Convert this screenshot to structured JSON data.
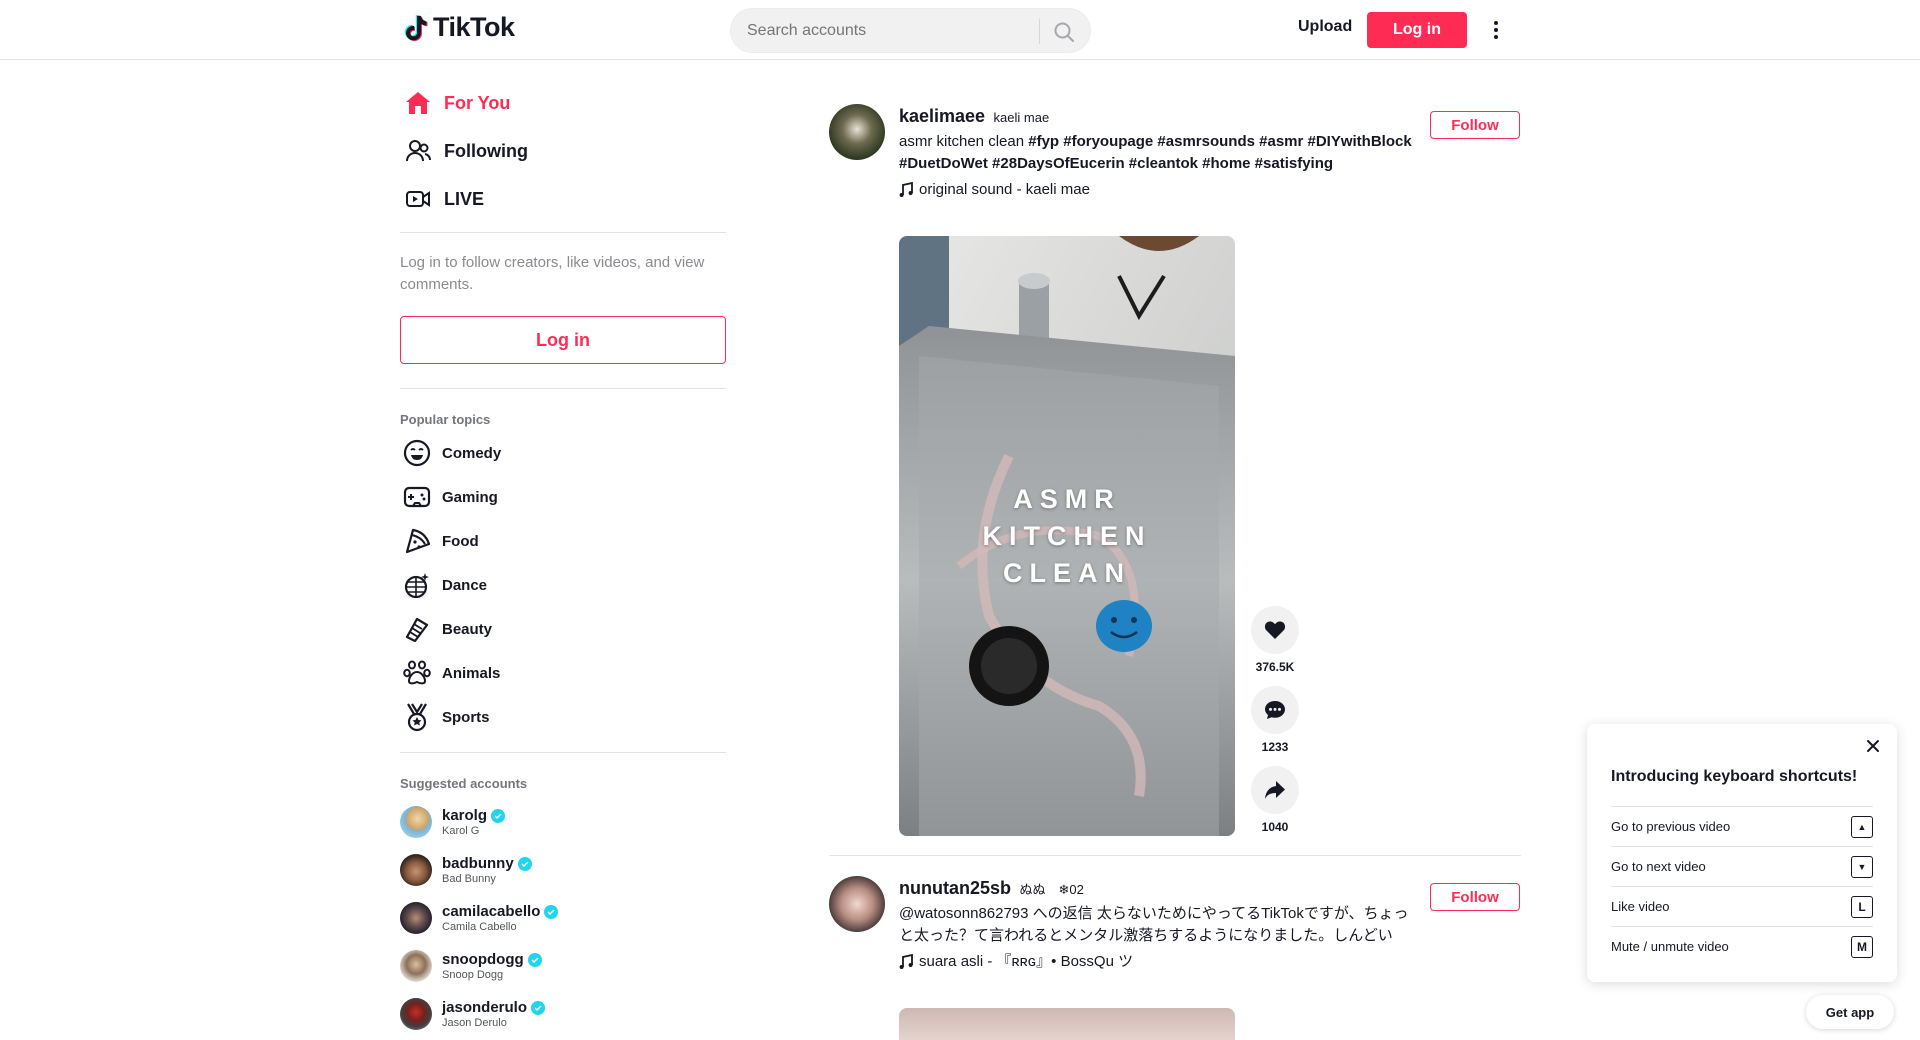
{
  "header": {
    "logo_text": "TikTok",
    "search_placeholder": "Search accounts",
    "upload_label": "Upload",
    "login_label": "Log in"
  },
  "sidebar": {
    "nav": [
      {
        "label": "For You",
        "icon": "home-icon",
        "active": true
      },
      {
        "label": "Following",
        "icon": "users-icon",
        "active": false
      },
      {
        "label": "LIVE",
        "icon": "live-icon",
        "active": false
      }
    ],
    "login_hint": "Log in to follow creators, like videos, and view comments.",
    "login_label": "Log in",
    "popular_topics_title": "Popular topics",
    "topics": [
      {
        "label": "Comedy",
        "icon": "laugh-face-icon"
      },
      {
        "label": "Gaming",
        "icon": "gamepad-icon"
      },
      {
        "label": "Food",
        "icon": "pizza-icon"
      },
      {
        "label": "Dance",
        "icon": "disco-ball-icon"
      },
      {
        "label": "Beauty",
        "icon": "comb-icon"
      },
      {
        "label": "Animals",
        "icon": "paw-icon"
      },
      {
        "label": "Sports",
        "icon": "medal-icon"
      }
    ],
    "suggested_title": "Suggested accounts",
    "accounts": [
      {
        "user": "karolg",
        "name": "Karol G"
      },
      {
        "user": "badbunny",
        "name": "Bad Bunny"
      },
      {
        "user": "camilacabello",
        "name": "Camila Cabello"
      },
      {
        "user": "snoopdogg",
        "name": "Snoop Dogg"
      },
      {
        "user": "jasonderulo",
        "name": "Jason Derulo"
      }
    ]
  },
  "feed": {
    "posts": [
      {
        "user": "kaelimaee",
        "nick": "kaeli mae",
        "desc_text": "asmr kitchen clean",
        "desc_tags": "#fyp #foryoupage #asmrsounds #asmr #DIYwithBlock #DuetDoWet #28DaysOfEucerin #cleantok #home #satisfying",
        "sound": "original sound - kaeli mae",
        "follow_label": "Follow",
        "video_overlay": "ASMR KITCHEN CLEAN",
        "likes": "376.5K",
        "comments": "1233",
        "shares": "1040"
      },
      {
        "user": "nunutan25sb",
        "nick": "ぬぬ ❄02",
        "desc_text": "@watosonn862793 への返信 太らないためにやってるTikTokですが、ちょっと太った？て言われるとメンタル激落ちするようになりました。しんどい",
        "sound": "suara asli - 『ʀʀɢ』• BossQu ツ",
        "follow_label": "Follow"
      }
    ]
  },
  "keyboard_popup": {
    "title": "Introducing keyboard shortcuts!",
    "rows": [
      {
        "label": "Go to previous video",
        "key": "▲"
      },
      {
        "label": "Go to next video",
        "key": "▼"
      },
      {
        "label": "Like video",
        "key": "L"
      },
      {
        "label": "Mute / unmute video",
        "key": "M"
      }
    ]
  },
  "get_app_label": "Get app",
  "colors": {
    "accent": "#fe2c55",
    "verified": "#20d5ec",
    "text": "#161823",
    "muted": "#8a8b91"
  }
}
